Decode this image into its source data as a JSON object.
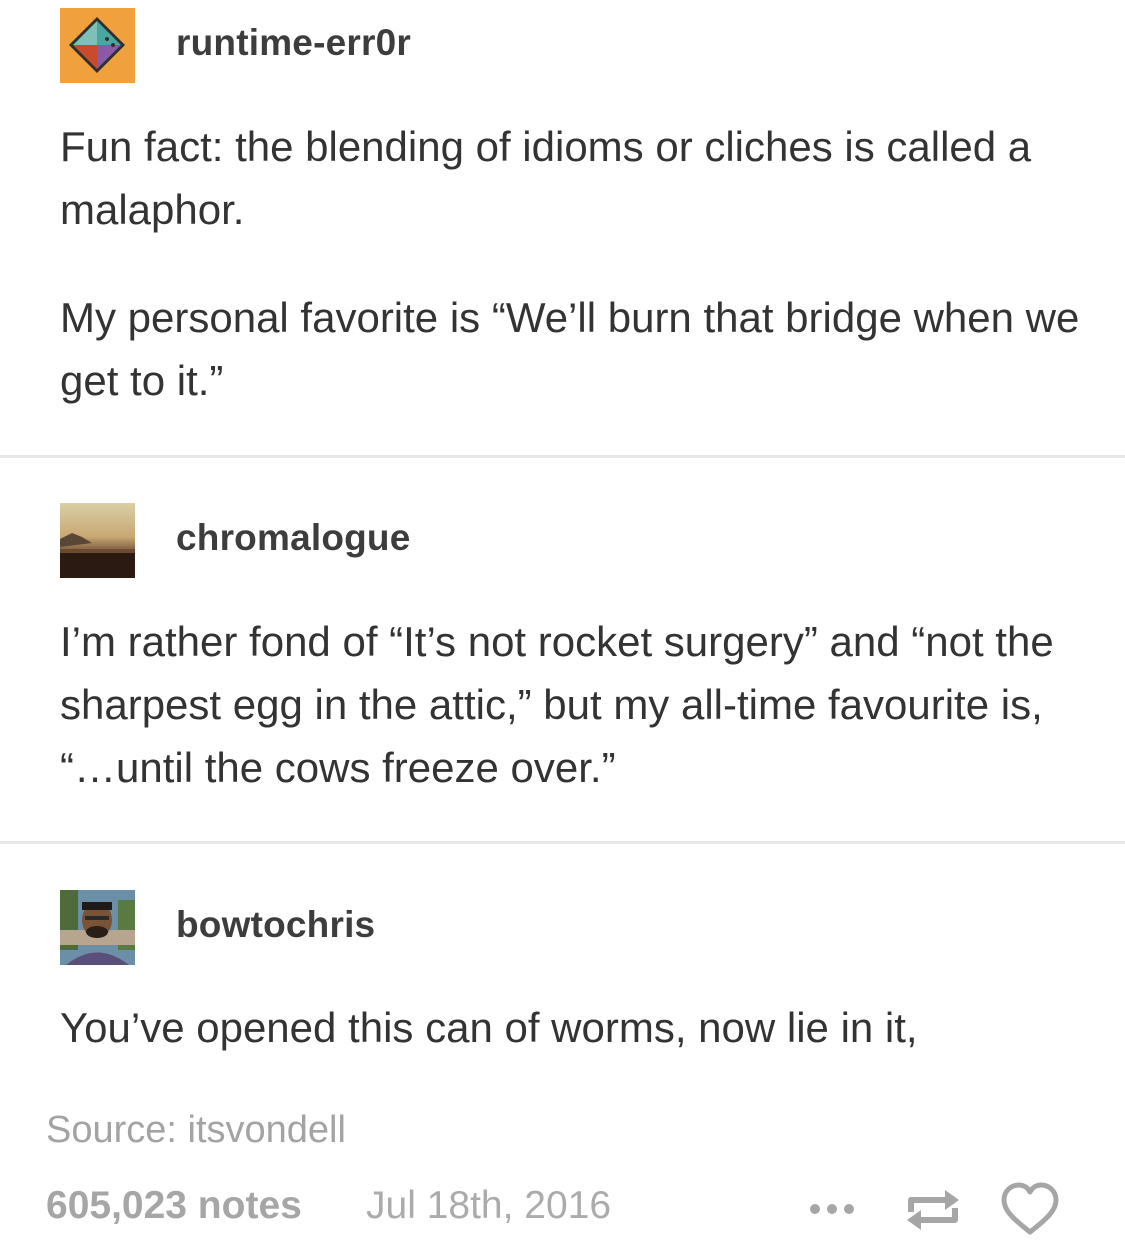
{
  "posts": [
    {
      "username": "runtime-err0r",
      "avatar": "diamond-logo-avatar",
      "paragraphs": [
        "Fun fact: the blending of idioms or cliches is called a malaphor.",
        "My personal favorite is “We’ll burn that bridge when we get to it.”"
      ]
    },
    {
      "username": "chromalogue",
      "avatar": "sunset-landscape-avatar",
      "paragraphs": [
        "I’m rather fond of “It’s not rocket surgery” and “not the sharpest egg in the attic,” but my all-time favourite is, “…until the cows freeze over.”"
      ]
    },
    {
      "username": "bowtochris",
      "avatar": "person-photo-avatar",
      "paragraphs": [
        "You’ve opened this can of worms, now lie in it,"
      ]
    }
  ],
  "footer": {
    "source": "Source: itsvondell",
    "notes": "605,023 notes",
    "date": "Jul 18th, 2016",
    "icons": [
      "more-icon",
      "reblog-icon",
      "like-icon"
    ]
  },
  "colors": {
    "text": "#333333",
    "muted": "#a6a6a6",
    "divider": "#e8e8e8",
    "avatar_orange": "#f0a03c"
  }
}
